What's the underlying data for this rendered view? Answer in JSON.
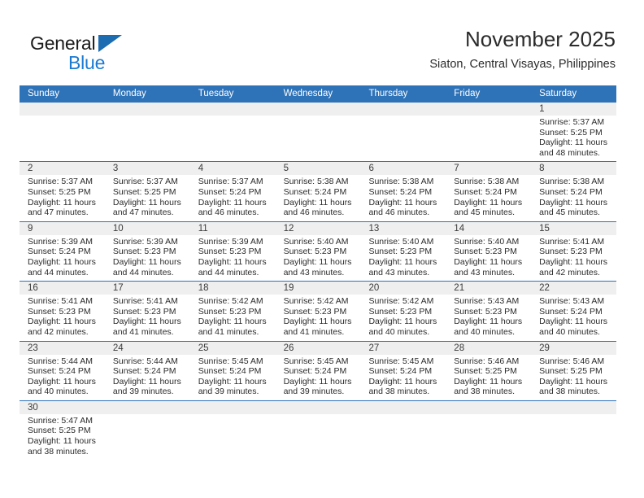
{
  "brand": {
    "name_part1": "General",
    "name_part2": "Blue",
    "accent_color": "#1b7ad1",
    "triangle_color": "#1b6cb0"
  },
  "header": {
    "title": "November 2025",
    "subtitle": "Siaton, Central Visayas, Philippines",
    "header_bg_color": "#2e72b8",
    "band_color": "#efefef"
  },
  "weekdays": [
    "Sunday",
    "Monday",
    "Tuesday",
    "Wednesday",
    "Thursday",
    "Friday",
    "Saturday"
  ],
  "weeks": [
    [
      {
        "empty": true
      },
      {
        "empty": true
      },
      {
        "empty": true
      },
      {
        "empty": true
      },
      {
        "empty": true
      },
      {
        "empty": true
      },
      {
        "day": "1",
        "sunrise": "Sunrise: 5:37 AM",
        "sunset": "Sunset: 5:25 PM",
        "daylight1": "Daylight: 11 hours",
        "daylight2": "and 48 minutes."
      }
    ],
    [
      {
        "day": "2",
        "sunrise": "Sunrise: 5:37 AM",
        "sunset": "Sunset: 5:25 PM",
        "daylight1": "Daylight: 11 hours",
        "daylight2": "and 47 minutes."
      },
      {
        "day": "3",
        "sunrise": "Sunrise: 5:37 AM",
        "sunset": "Sunset: 5:25 PM",
        "daylight1": "Daylight: 11 hours",
        "daylight2": "and 47 minutes."
      },
      {
        "day": "4",
        "sunrise": "Sunrise: 5:37 AM",
        "sunset": "Sunset: 5:24 PM",
        "daylight1": "Daylight: 11 hours",
        "daylight2": "and 46 minutes."
      },
      {
        "day": "5",
        "sunrise": "Sunrise: 5:38 AM",
        "sunset": "Sunset: 5:24 PM",
        "daylight1": "Daylight: 11 hours",
        "daylight2": "and 46 minutes."
      },
      {
        "day": "6",
        "sunrise": "Sunrise: 5:38 AM",
        "sunset": "Sunset: 5:24 PM",
        "daylight1": "Daylight: 11 hours",
        "daylight2": "and 46 minutes."
      },
      {
        "day": "7",
        "sunrise": "Sunrise: 5:38 AM",
        "sunset": "Sunset: 5:24 PM",
        "daylight1": "Daylight: 11 hours",
        "daylight2": "and 45 minutes."
      },
      {
        "day": "8",
        "sunrise": "Sunrise: 5:38 AM",
        "sunset": "Sunset: 5:24 PM",
        "daylight1": "Daylight: 11 hours",
        "daylight2": "and 45 minutes."
      }
    ],
    [
      {
        "day": "9",
        "sunrise": "Sunrise: 5:39 AM",
        "sunset": "Sunset: 5:24 PM",
        "daylight1": "Daylight: 11 hours",
        "daylight2": "and 44 minutes."
      },
      {
        "day": "10",
        "sunrise": "Sunrise: 5:39 AM",
        "sunset": "Sunset: 5:23 PM",
        "daylight1": "Daylight: 11 hours",
        "daylight2": "and 44 minutes."
      },
      {
        "day": "11",
        "sunrise": "Sunrise: 5:39 AM",
        "sunset": "Sunset: 5:23 PM",
        "daylight1": "Daylight: 11 hours",
        "daylight2": "and 44 minutes."
      },
      {
        "day": "12",
        "sunrise": "Sunrise: 5:40 AM",
        "sunset": "Sunset: 5:23 PM",
        "daylight1": "Daylight: 11 hours",
        "daylight2": "and 43 minutes."
      },
      {
        "day": "13",
        "sunrise": "Sunrise: 5:40 AM",
        "sunset": "Sunset: 5:23 PM",
        "daylight1": "Daylight: 11 hours",
        "daylight2": "and 43 minutes."
      },
      {
        "day": "14",
        "sunrise": "Sunrise: 5:40 AM",
        "sunset": "Sunset: 5:23 PM",
        "daylight1": "Daylight: 11 hours",
        "daylight2": "and 43 minutes."
      },
      {
        "day": "15",
        "sunrise": "Sunrise: 5:41 AM",
        "sunset": "Sunset: 5:23 PM",
        "daylight1": "Daylight: 11 hours",
        "daylight2": "and 42 minutes."
      }
    ],
    [
      {
        "day": "16",
        "sunrise": "Sunrise: 5:41 AM",
        "sunset": "Sunset: 5:23 PM",
        "daylight1": "Daylight: 11 hours",
        "daylight2": "and 42 minutes."
      },
      {
        "day": "17",
        "sunrise": "Sunrise: 5:41 AM",
        "sunset": "Sunset: 5:23 PM",
        "daylight1": "Daylight: 11 hours",
        "daylight2": "and 41 minutes."
      },
      {
        "day": "18",
        "sunrise": "Sunrise: 5:42 AM",
        "sunset": "Sunset: 5:23 PM",
        "daylight1": "Daylight: 11 hours",
        "daylight2": "and 41 minutes."
      },
      {
        "day": "19",
        "sunrise": "Sunrise: 5:42 AM",
        "sunset": "Sunset: 5:23 PM",
        "daylight1": "Daylight: 11 hours",
        "daylight2": "and 41 minutes."
      },
      {
        "day": "20",
        "sunrise": "Sunrise: 5:42 AM",
        "sunset": "Sunset: 5:23 PM",
        "daylight1": "Daylight: 11 hours",
        "daylight2": "and 40 minutes."
      },
      {
        "day": "21",
        "sunrise": "Sunrise: 5:43 AM",
        "sunset": "Sunset: 5:23 PM",
        "daylight1": "Daylight: 11 hours",
        "daylight2": "and 40 minutes."
      },
      {
        "day": "22",
        "sunrise": "Sunrise: 5:43 AM",
        "sunset": "Sunset: 5:24 PM",
        "daylight1": "Daylight: 11 hours",
        "daylight2": "and 40 minutes."
      }
    ],
    [
      {
        "day": "23",
        "sunrise": "Sunrise: 5:44 AM",
        "sunset": "Sunset: 5:24 PM",
        "daylight1": "Daylight: 11 hours",
        "daylight2": "and 40 minutes."
      },
      {
        "day": "24",
        "sunrise": "Sunrise: 5:44 AM",
        "sunset": "Sunset: 5:24 PM",
        "daylight1": "Daylight: 11 hours",
        "daylight2": "and 39 minutes."
      },
      {
        "day": "25",
        "sunrise": "Sunrise: 5:45 AM",
        "sunset": "Sunset: 5:24 PM",
        "daylight1": "Daylight: 11 hours",
        "daylight2": "and 39 minutes."
      },
      {
        "day": "26",
        "sunrise": "Sunrise: 5:45 AM",
        "sunset": "Sunset: 5:24 PM",
        "daylight1": "Daylight: 11 hours",
        "daylight2": "and 39 minutes."
      },
      {
        "day": "27",
        "sunrise": "Sunrise: 5:45 AM",
        "sunset": "Sunset: 5:24 PM",
        "daylight1": "Daylight: 11 hours",
        "daylight2": "and 38 minutes."
      },
      {
        "day": "28",
        "sunrise": "Sunrise: 5:46 AM",
        "sunset": "Sunset: 5:25 PM",
        "daylight1": "Daylight: 11 hours",
        "daylight2": "and 38 minutes."
      },
      {
        "day": "29",
        "sunrise": "Sunrise: 5:46 AM",
        "sunset": "Sunset: 5:25 PM",
        "daylight1": "Daylight: 11 hours",
        "daylight2": "and 38 minutes."
      }
    ],
    [
      {
        "day": "30",
        "sunrise": "Sunrise: 5:47 AM",
        "sunset": "Sunset: 5:25 PM",
        "daylight1": "Daylight: 11 hours",
        "daylight2": "and 38 minutes."
      },
      {
        "empty": true
      },
      {
        "empty": true
      },
      {
        "empty": true
      },
      {
        "empty": true
      },
      {
        "empty": true
      },
      {
        "empty": true
      }
    ]
  ]
}
